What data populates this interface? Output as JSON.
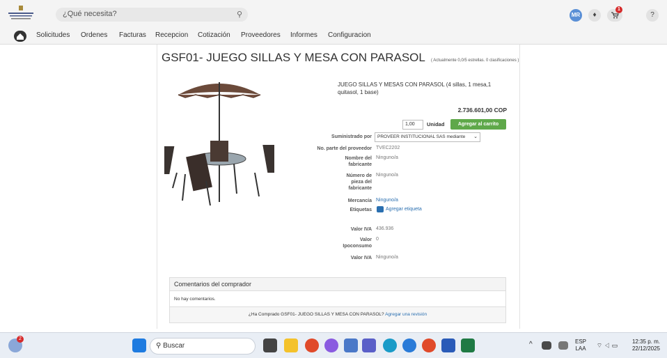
{
  "header": {
    "search_placeholder": "¿Qué necesita?",
    "avatar_initials": "MR",
    "bell": "♦",
    "cart_badge": "1",
    "help": "?"
  },
  "nav": {
    "items": [
      "Solicitudes",
      "Ordenes",
      "Facturas",
      "Recepcion",
      "Cotización",
      "Proveedores",
      "Informes",
      "Configuracion"
    ]
  },
  "product": {
    "title": "GSF01- JUEGO SILLAS Y MESA CON PARASOL",
    "rating_note": "( Actualmente 0,0/5 estrellas. 0 clasificaciones )",
    "description": "JUEGO SILLAS Y MESAS CON PARASOL (4 sillas, 1 mesa,1 quitasol, 1 base)",
    "price": "2.736.601,00 COP",
    "quantity": "1,00",
    "unit_label": "Unidad",
    "add_to_cart": "Agregar al carrito"
  },
  "details": {
    "supplied_by_label": "Suministrado por",
    "supplied_by_value": "PROVEER INSTITUCIONAL SAS mediante",
    "supplier_part_label": "No. parte del proveedor",
    "supplier_part_value": "TVEC2202",
    "manufacturer_label": "Nombre del fabricante",
    "manufacturer_value": "Ninguno/a",
    "mfr_part_label": "Número de pieza del fabricante",
    "mfr_part_value": "Ninguno/a",
    "commodity_label": "Mercancía",
    "commodity_value": "Ninguno/a",
    "tags_label": "Etiquetas",
    "tags_value": "Agregar etiqueta",
    "iva_label": "Valor IVA",
    "iva_value": "436.936",
    "ipoconsumo_label": "Valor Ipoconsumo",
    "ipoconsumo_value": "0",
    "iva2_label": "Valor IVA",
    "iva2_value": "Ninguno/a"
  },
  "comments": {
    "header": "Comentarios del comprador",
    "empty": "No hay comentarios.",
    "prompt": "¿Ha Comprado GSF01- JUEGO SILLAS Y MESA CON PARASOL?",
    "review_link": "Agregar una revisión"
  },
  "taskbar": {
    "weather_badge": "2",
    "search": "Buscar",
    "lang_top": "ESP",
    "lang_bottom": "LAA",
    "time": "12:35 p. m.",
    "date": "22/12/2025"
  }
}
